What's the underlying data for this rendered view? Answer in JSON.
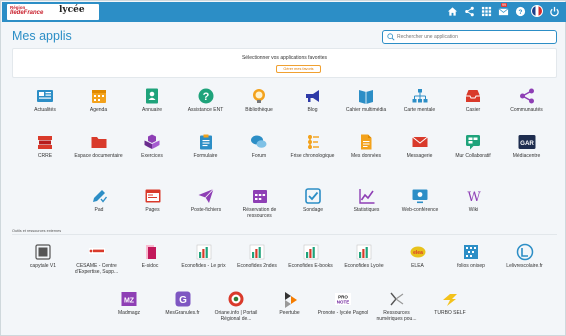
{
  "header": {
    "logo_region_line1": "Région",
    "logo_region_line2": "IledeFrance",
    "logo_lycee": "lycée",
    "mail_count": "99"
  },
  "page": {
    "title": "Mes applis"
  },
  "search": {
    "placeholder": "Rechercher une application"
  },
  "favorites": {
    "prompt": "Sélectionner vos applications favorites",
    "button": "Gérer mes favoris"
  },
  "apps_row1": [
    {
      "label": "Actualités",
      "icon": "newspaper-icon",
      "color": "#2c8ec6"
    },
    {
      "label": "Agenda",
      "icon": "calendar-icon",
      "color": "#f3a21c"
    },
    {
      "label": "Annuaire",
      "icon": "contacts-book-icon",
      "color": "#1fa37b"
    },
    {
      "label": "Assistance ENT",
      "icon": "help-circle-icon",
      "color": "#1fa37b"
    },
    {
      "label": "Bibliothèque",
      "icon": "lightbulb-icon",
      "color": "#f3a21c"
    },
    {
      "label": "Blog",
      "icon": "megaphone-icon",
      "color": "#2e3aa8"
    },
    {
      "label": "Cahier multimédia",
      "icon": "book-icon",
      "color": "#2c8ec6"
    },
    {
      "label": "Carte mentale",
      "icon": "sitemap-icon",
      "color": "#2c8ec6"
    },
    {
      "label": "Casier",
      "icon": "inbox-tray-icon",
      "color": "#d93a2b"
    },
    {
      "label": "Communautés",
      "icon": "share-nodes-icon",
      "color": "#8e3fb5"
    }
  ],
  "apps_row2": [
    {
      "label": "CRRE",
      "icon": "books-red-icon",
      "color": "#d93a2b"
    },
    {
      "label": "Espace documentaire",
      "icon": "folder-icon",
      "color": "#d93a2b"
    },
    {
      "label": "Exercices",
      "icon": "cubes-icon",
      "color": "#8e3fb5"
    },
    {
      "label": "Formulaire",
      "icon": "clipboard-icon",
      "color": "#2c8ec6"
    },
    {
      "label": "Forum",
      "icon": "chat-bubbles-icon",
      "color": "#2c8ec6"
    },
    {
      "label": "Frise chronologique",
      "icon": "timeline-icon",
      "color": "#f3a21c"
    },
    {
      "label": "Mes données",
      "icon": "document-icon",
      "color": "#f3a21c"
    },
    {
      "label": "Messagerie",
      "icon": "envelope-icon",
      "color": "#d93a2b"
    },
    {
      "label": "Mur Collaboratif",
      "icon": "speech-board-icon",
      "color": "#1fa37b"
    },
    {
      "label": "Médiacentre",
      "icon": "gar-logo-icon",
      "color": "#1e2d4f"
    }
  ],
  "apps_row3": [
    {
      "label": "Pad",
      "icon": "pencil-check-icon",
      "color": "#2c8ec6"
    },
    {
      "label": "Pages",
      "icon": "browser-window-icon",
      "color": "#d93a2b"
    },
    {
      "label": "Poste-fichiers",
      "icon": "paper-plane-icon",
      "color": "#8e3fb5"
    },
    {
      "label": "Réservation de ressources",
      "icon": "calendar-grid-icon",
      "color": "#8e3fb5"
    },
    {
      "label": "Sondage",
      "icon": "check-square-icon",
      "color": "#2c8ec6"
    },
    {
      "label": "Statistiques",
      "icon": "line-chart-icon",
      "color": "#8e3fb5"
    },
    {
      "label": "Web-conférence",
      "icon": "video-screen-icon",
      "color": "#2c8ec6"
    },
    {
      "label": "Wiki",
      "icon": "wikipedia-icon",
      "color": "#8e3fb5"
    }
  ],
  "external_section_label": "Outils et ressources externes",
  "apps_row4": [
    {
      "label": "capytale V1",
      "icon": "capytale-icon",
      "color": "#555555"
    },
    {
      "label": "CESAME - Centre d'Expertise, Supp...",
      "icon": "cesame-logo-icon",
      "color": "#d93a2b"
    },
    {
      "label": "E-sidoc",
      "icon": "esidoc-icon",
      "color": "#c2185b"
    },
    {
      "label": "Econofides - Le prix",
      "icon": "econofides-icon",
      "color": "#1fa37b"
    },
    {
      "label": "Econofides 2ndes",
      "icon": "econofides-icon",
      "color": "#1fa37b"
    },
    {
      "label": "Econofides E-books",
      "icon": "econofides-icon",
      "color": "#1fa37b"
    },
    {
      "label": "Econofides Lycée",
      "icon": "econofides-icon",
      "color": "#1fa37b"
    },
    {
      "label": "ELEA",
      "icon": "elea-icon",
      "color": "#e8c21c"
    },
    {
      "label": "folios onisep",
      "icon": "folios-icon",
      "color": "#2c8ec6"
    },
    {
      "label": "Lelivrescolaire.fr",
      "icon": "livrescolaire-icon",
      "color": "#2c8ec6"
    }
  ],
  "apps_row5": [
    {
      "label": "Madmagz",
      "icon": "madmagz-icon",
      "color": "#8e3fb5"
    },
    {
      "label": "MesGranules.fr",
      "icon": "mesgranules-icon",
      "color": "#7e57c2"
    },
    {
      "label": "Oriane.info | Portail Régional de...",
      "icon": "oriane-icon",
      "color": "#d93a2b"
    },
    {
      "label": "Peertube",
      "icon": "peertube-icon",
      "color": "#f57c00"
    },
    {
      "label": "Pronote - lycée Pagnol",
      "icon": "pronote-icon",
      "color": "#2e7d32"
    },
    {
      "label": "Ressources numériques pou...",
      "icon": "ressources-icon",
      "color": "#555555"
    },
    {
      "label": "TURBO SELF",
      "icon": "turboself-icon",
      "color": "#f3c21c"
    }
  ]
}
